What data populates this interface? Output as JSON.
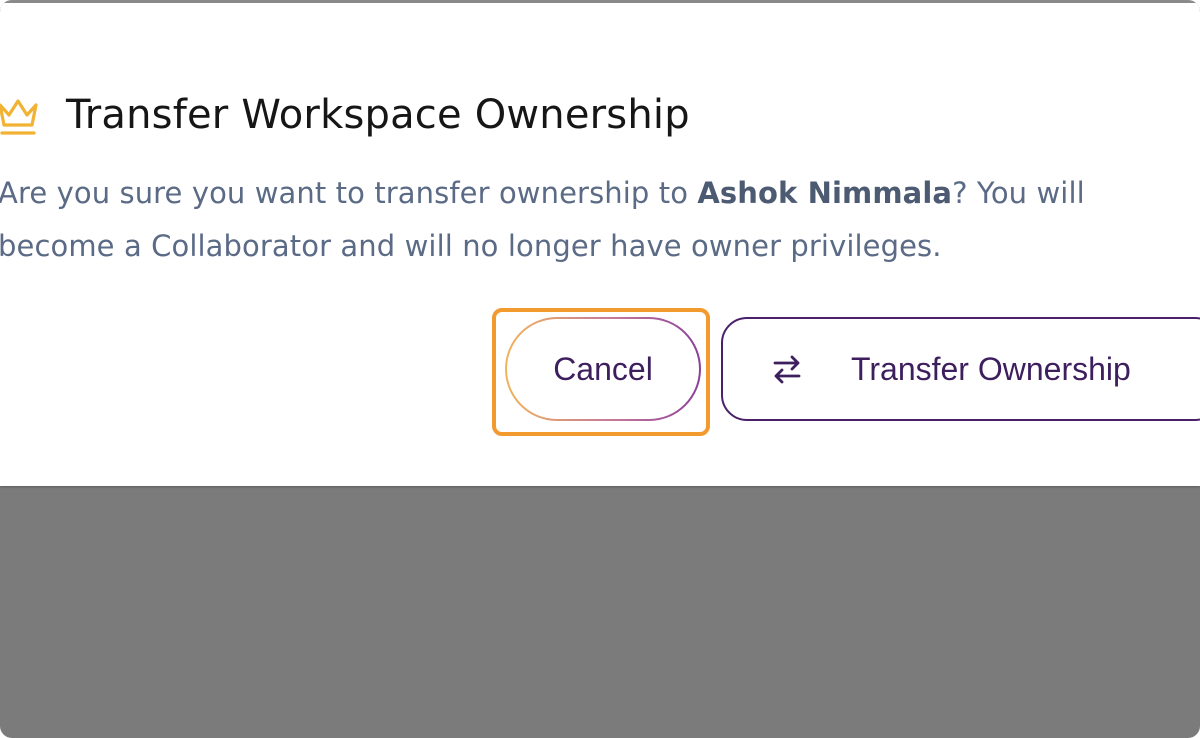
{
  "dialog": {
    "title": "Transfer Workspace Ownership",
    "title_icon": "crown-icon",
    "message_pre": "Are you sure you want to transfer ownership to ",
    "message_name": "Ashok Nimmala",
    "message_post": "? You will become a Collaborator and will no longer have owner privileges.",
    "cancel_label": "Cancel",
    "confirm_label": "Transfer Ownership",
    "confirm_icon": "swap-arrows-icon"
  },
  "colors": {
    "accent_orange": "#f29a2e",
    "primary_purple": "#3e1f5e",
    "crown_gold": "#f2b233",
    "message_text": "#5b6b86",
    "backdrop": "#7b7b7b"
  }
}
